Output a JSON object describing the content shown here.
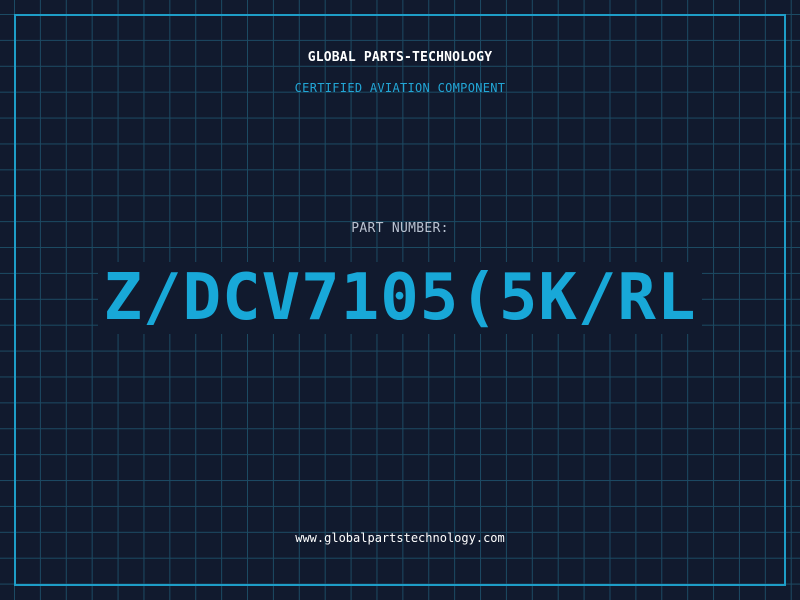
{
  "header": {
    "company": "GLOBAL PARTS-TECHNOLOGY",
    "tagline": "CERTIFIED AVIATION COMPONENT"
  },
  "part": {
    "label": "PART NUMBER:",
    "number": "Z/DCV7105(5K/RL"
  },
  "footer": {
    "url": "www.globalpartstechnology.com"
  },
  "colors": {
    "background": "#111a2e",
    "grid": "#1c4a63",
    "accent": "#1e9dc7",
    "part_number": "#18a8d8"
  }
}
